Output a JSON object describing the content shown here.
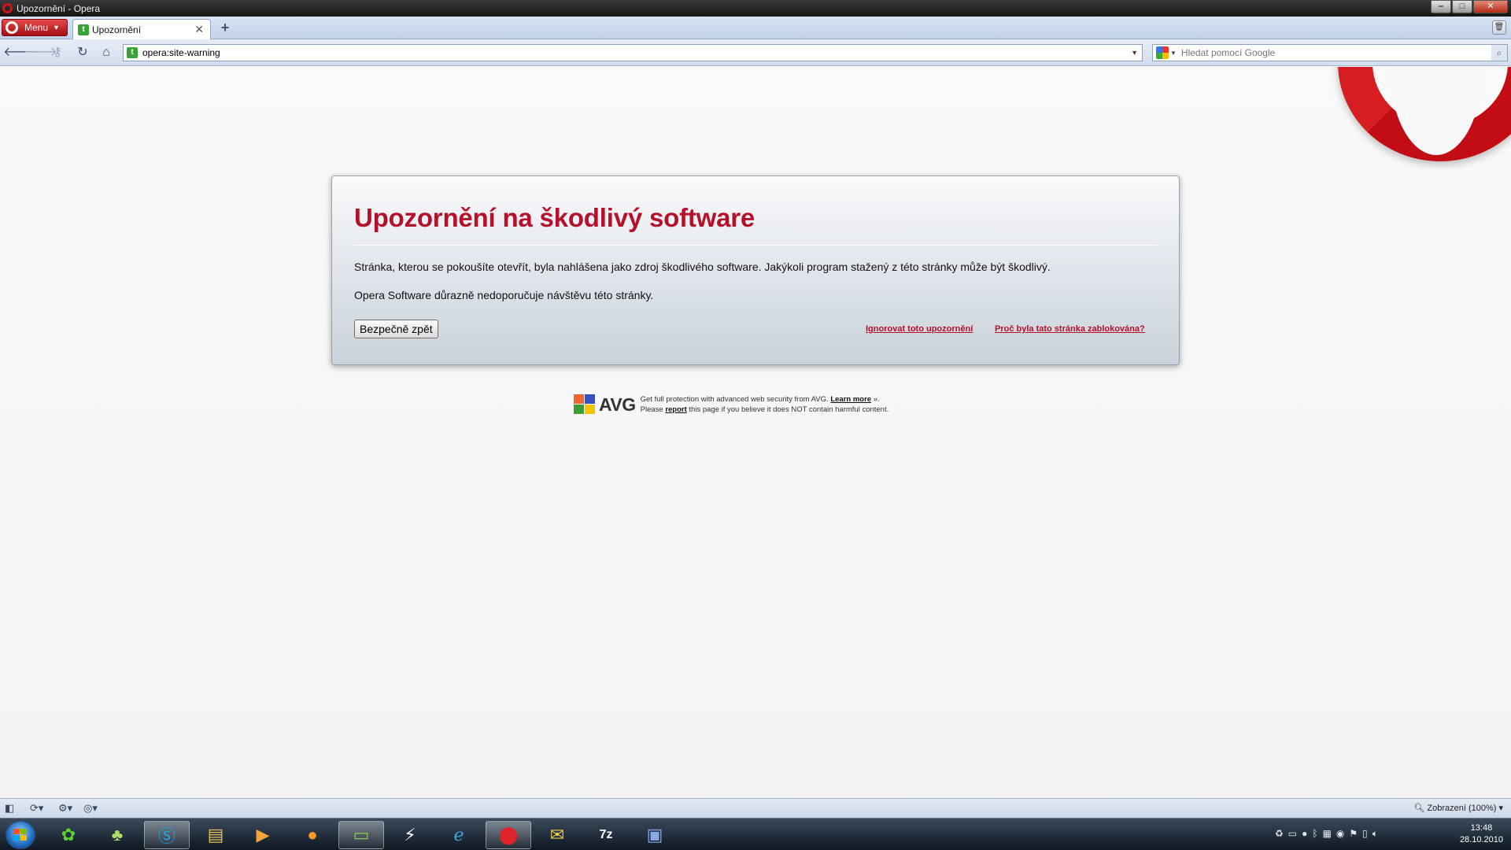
{
  "window": {
    "title": "Upozornění - Opera"
  },
  "menu": {
    "label": "Menu"
  },
  "tabs": [
    {
      "label": "Upozornění"
    }
  ],
  "address": {
    "url": "opera:site-warning"
  },
  "search": {
    "placeholder": "Hledat pomocí Google"
  },
  "warning": {
    "title": "Upozornění na škodlivý software",
    "paragraph1": "Stránka, kterou se pokoušíte otevřít, byla nahlášena jako zdroj škodlivého software. Jakýkoli program stažený z této stránky může být škodlivý.",
    "paragraph2": "Opera Software důrazně nedoporučuje návštěvu této stránky.",
    "back_button": "Bezpečně zpět",
    "ignore_link": "Ignorovat toto upozornění",
    "why_link": "Proč byla tato stránka zablokována?"
  },
  "avg": {
    "brand": "AVG",
    "line1_a": "Get full protection with advanced web security from AVG.",
    "learn_more": "Learn more",
    "line1_b": " ».",
    "line2_a": "Please ",
    "report": "report",
    "line2_b": " this page if you believe it does NOT contain harmful content."
  },
  "statusbar": {
    "zoom": "Zobrazení (100%)"
  },
  "taskbar": {
    "time": "13:48",
    "date": "28.10.2010"
  },
  "colors": {
    "accent_red": "#b6112b",
    "opera_red": "#c30d15"
  }
}
